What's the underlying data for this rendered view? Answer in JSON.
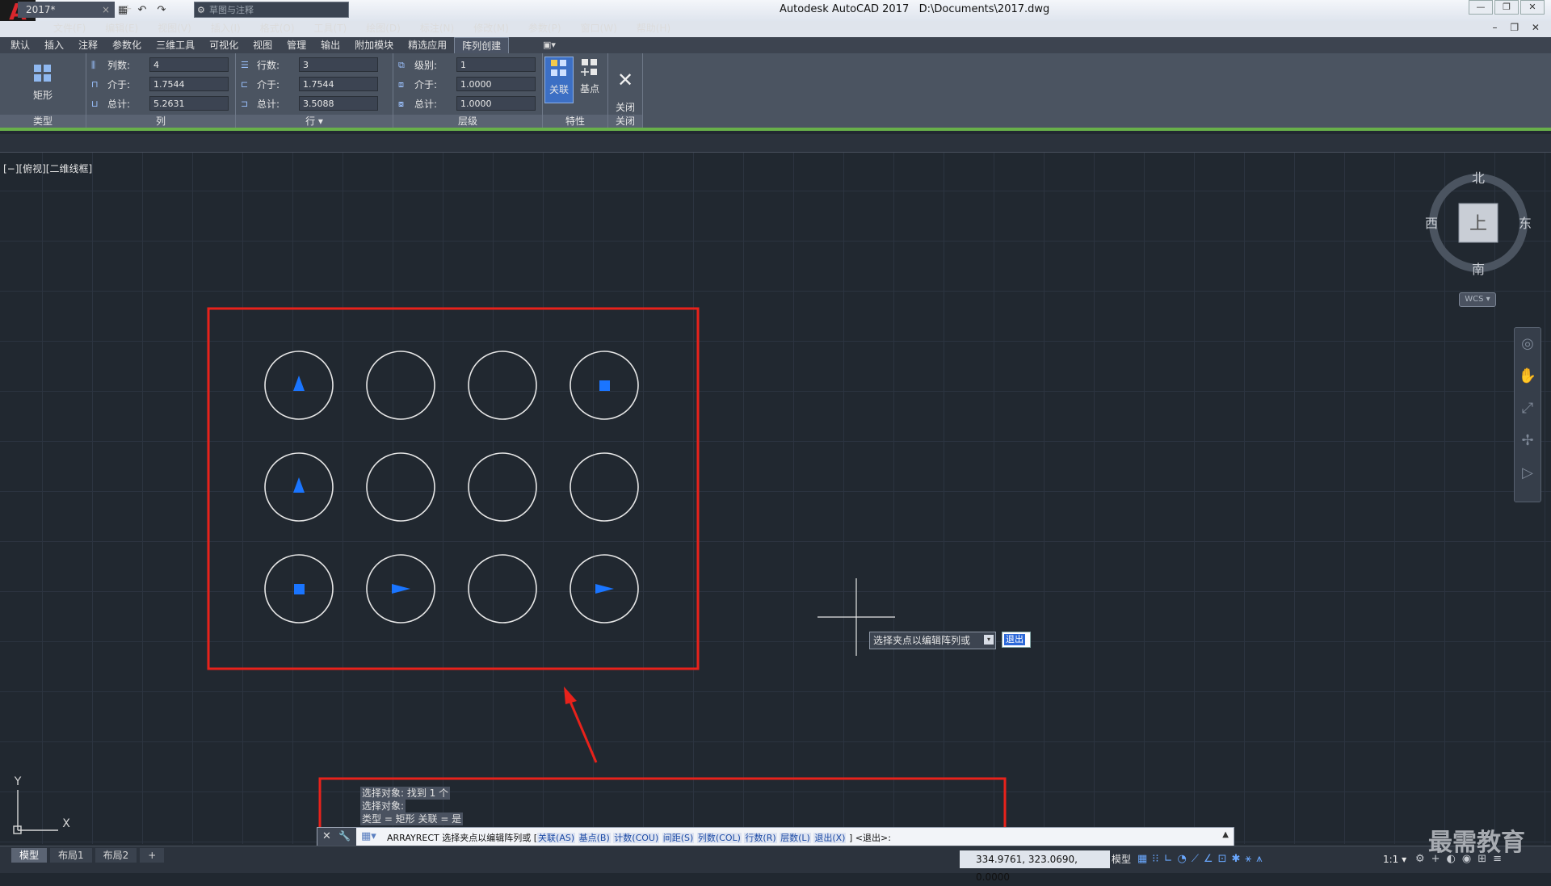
{
  "titlebar": {
    "app_title": "Autodesk AutoCAD 2017",
    "file_path": "D:\\Documents\\2017.dwg",
    "workspace": "草图与注释",
    "window_buttons": [
      "—",
      "❐",
      "✕"
    ]
  },
  "menu": {
    "items": [
      "文件(F)",
      "编辑(E)",
      "视图(V)",
      "插入(I)",
      "格式(O)",
      "工具(T)",
      "绘图(D)",
      "标注(N)",
      "修改(M)",
      "参数(P)",
      "窗口(W)",
      "帮助(H)"
    ],
    "doc_buttons": "– ❐ ✕"
  },
  "ribbon_tabs": {
    "items": [
      "默认",
      "插入",
      "注释",
      "参数化",
      "三维工具",
      "可视化",
      "视图",
      "管理",
      "输出",
      "附加模块",
      "精选应用",
      "阵列创建"
    ],
    "active": "阵列创建",
    "extra": "▣▾"
  },
  "ribbon": {
    "type_panel": {
      "button": "矩形",
      "label": "类型"
    },
    "columns_panel": {
      "label": "列",
      "fields": [
        {
          "label": "列数:",
          "value": "4"
        },
        {
          "label": "介于:",
          "value": "1.7544"
        },
        {
          "label": "总计:",
          "value": "5.2631"
        }
      ]
    },
    "rows_panel": {
      "label": "行 ▾",
      "fields": [
        {
          "label": "行数:",
          "value": "3"
        },
        {
          "label": "介于:",
          "value": "1.7544"
        },
        {
          "label": "总计:",
          "value": "3.5088"
        }
      ]
    },
    "levels_panel": {
      "label": "层级",
      "fields": [
        {
          "label": "级别:",
          "value": "1"
        },
        {
          "label": "介于:",
          "value": "1.0000"
        },
        {
          "label": "总计:",
          "value": "1.0000"
        }
      ]
    },
    "properties_panel": {
      "label": "特性",
      "associative": "关联",
      "basepoint": "基点"
    },
    "close_panel": {
      "label": "关闭",
      "button": "关闭\n阵列"
    }
  },
  "doc_tabs": {
    "active": "2017*",
    "close": "×",
    "add": "+"
  },
  "viewport": {
    "label": "[−][俯视][二维线框]"
  },
  "viewcube": {
    "north": "北",
    "south": "南",
    "east": "东",
    "west": "西",
    "top": "上",
    "wcs": "WCS ▾"
  },
  "prompt": {
    "text": "选择夹点以编辑阵列或",
    "input": "退出"
  },
  "command": {
    "history": [
      "选择对象: 找到 1 个",
      "选择对象:",
      "类型 = 矩形  关联 = 是"
    ],
    "prefix": "ARRAYRECT 选择夹点以编辑阵列或 [",
    "options": [
      "关联(AS)",
      "基点(B)",
      "计数(COU)",
      "间距(S)",
      "列数(COL)",
      "行数(R)",
      "层数(L)",
      "退出(X)"
    ],
    "suffix": "] <退出>:"
  },
  "status": {
    "layout_tabs": [
      "模型",
      "布局1",
      "布局2"
    ],
    "coords": "334.9761, 323.0690, 0.0000",
    "model": "模型",
    "scale": "1:1 ▾",
    "watermark": "最需教育"
  },
  "ucs": {
    "x": "X",
    "y": "Y"
  },
  "colors": {
    "grip_blue": "#1a75ff",
    "annotation_red": "#e8221b",
    "ribbon_green": "#68b04a"
  }
}
